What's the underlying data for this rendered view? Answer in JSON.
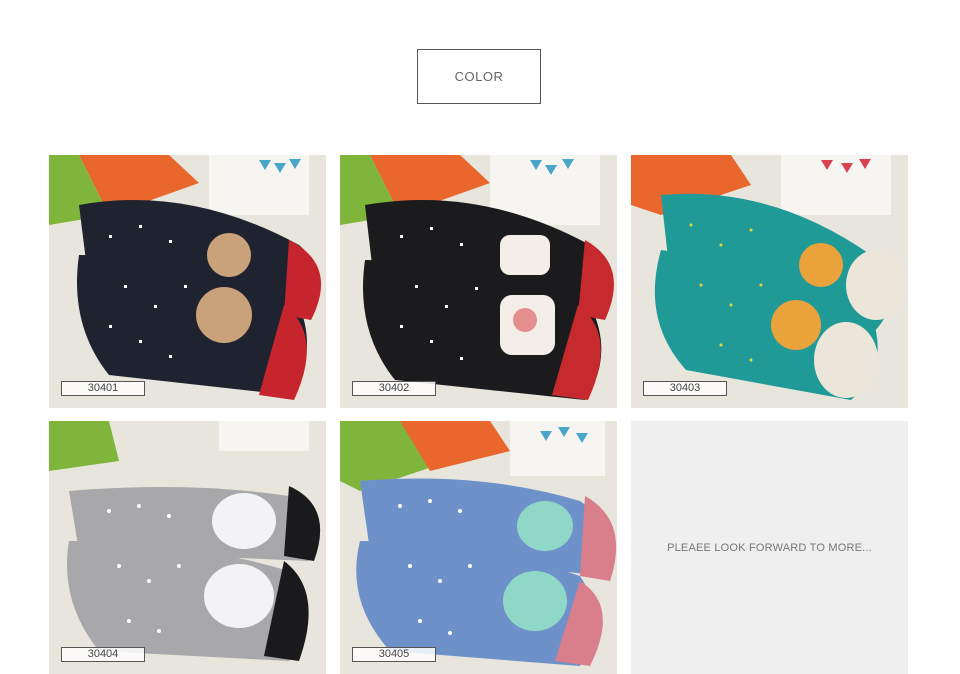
{
  "header": {
    "title": "COLOR"
  },
  "products": [
    {
      "code": "30401",
      "sock_color": "#1f2330",
      "toe_color": "#c7252e",
      "motif": "reindeer"
    },
    {
      "code": "30402",
      "sock_color": "#1b1b1d",
      "toe_color": "#c62a2f",
      "motif": "santa"
    },
    {
      "code": "30403",
      "sock_color": "#1f9a96",
      "toe_color": "#ece6da",
      "motif": "giraffe"
    },
    {
      "code": "30404",
      "sock_color": "#a8a8aa",
      "toe_color": "#1a1a1c",
      "motif": "bunny"
    },
    {
      "code": "30405",
      "sock_color": "#6f91c9",
      "toe_color": "#d97f8c",
      "motif": "frog"
    }
  ],
  "placeholder": {
    "text": "PLEAEE LOOK FORWARD TO MORE..."
  }
}
